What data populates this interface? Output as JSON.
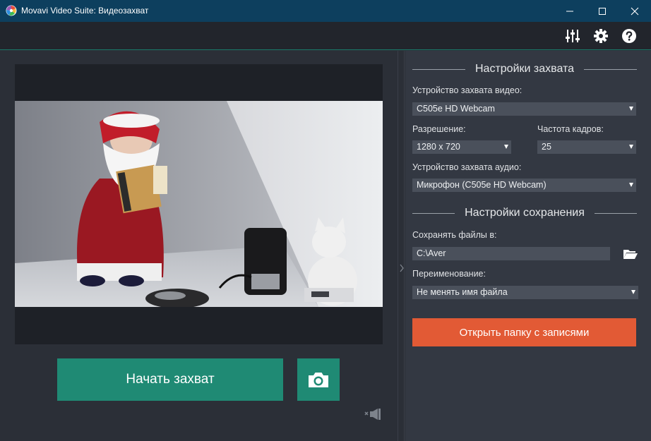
{
  "window": {
    "title": "Movavi Video Suite: Видеозахват"
  },
  "toolbar": {
    "icons": [
      "equalizer-icon",
      "gear-icon",
      "help-icon"
    ]
  },
  "capture": {
    "start_label": "Начать захват"
  },
  "settings": {
    "capture_title": "Настройки захвата",
    "video_device_label": "Устройство захвата видео:",
    "video_device_value": "C505e HD Webcam",
    "resolution_label": "Разрешение:",
    "resolution_value": "1280 x 720",
    "fps_label": "Частота кадров:",
    "fps_value": "25",
    "audio_device_label": "Устройство захвата аудио:",
    "audio_device_value": "Микрофон (C505e HD Webcam)",
    "save_title": "Настройки сохранения",
    "save_to_label": "Сохранять файлы в:",
    "save_to_value": "C:\\Aver",
    "rename_label": "Переименование:",
    "rename_value": "Не менять имя файла",
    "open_folder_label": "Открыть папку с записями"
  },
  "colors": {
    "titlebar": "#0d3f5e",
    "accent_green": "#1f8a74",
    "accent_orange": "#e25a35",
    "panel": "#333842"
  }
}
